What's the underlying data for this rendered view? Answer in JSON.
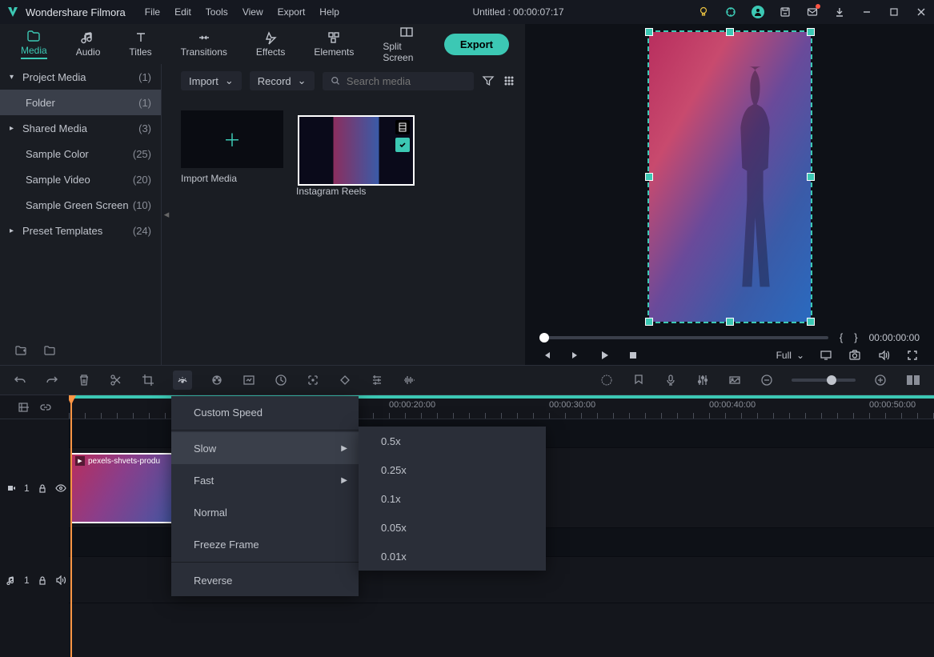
{
  "app": {
    "name": "Wondershare Filmora"
  },
  "menu": {
    "file": "File",
    "edit": "Edit",
    "tools": "Tools",
    "view": "View",
    "export": "Export",
    "help": "Help"
  },
  "document": {
    "title": "Untitled : 00:00:07:17"
  },
  "tabs": {
    "media": "Media",
    "audio": "Audio",
    "titles": "Titles",
    "transitions": "Transitions",
    "effects": "Effects",
    "elements": "Elements",
    "splitscreen": "Split Screen"
  },
  "export": {
    "label": "Export"
  },
  "sidebar": {
    "items": [
      {
        "label": "Project Media",
        "count": "(1)",
        "arrow": "▾"
      },
      {
        "label": "Folder",
        "count": "(1)",
        "indent": true,
        "selected": true
      },
      {
        "label": "Shared Media",
        "count": "(3)",
        "arrow": "▸"
      },
      {
        "label": "Sample Color",
        "count": "(25)",
        "indent": true
      },
      {
        "label": "Sample Video",
        "count": "(20)",
        "indent": true
      },
      {
        "label": "Sample Green Screen",
        "count": "(10)",
        "indent": true
      },
      {
        "label": "Preset Templates",
        "count": "(24)",
        "arrow": "▸"
      }
    ]
  },
  "mediaToolbar": {
    "import": "Import",
    "record": "Record",
    "searchPlaceholder": "Search media"
  },
  "mediaCards": {
    "import": "Import Media",
    "clip1": "Instagram Reels"
  },
  "preview": {
    "quality": "Full",
    "startBrace": "{",
    "endBrace": "}",
    "timecode": "00:00:00:00"
  },
  "ruler": {
    "marks": [
      "00:00:20:00",
      "00:00:30:00",
      "00:00:40:00",
      "00:00:50:00"
    ]
  },
  "tracks": {
    "video": "1",
    "audio": "1"
  },
  "clip": {
    "name": "pexels-shvets-produ"
  },
  "speedMenu": {
    "custom": "Custom Speed",
    "slow": "Slow",
    "fast": "Fast",
    "normal": "Normal",
    "freeze": "Freeze Frame",
    "reverse": "Reverse"
  },
  "slowSubmenu": {
    "o1": "0.5x",
    "o2": "0.25x",
    "o3": "0.1x",
    "o4": "0.05x",
    "o5": "0.01x"
  }
}
